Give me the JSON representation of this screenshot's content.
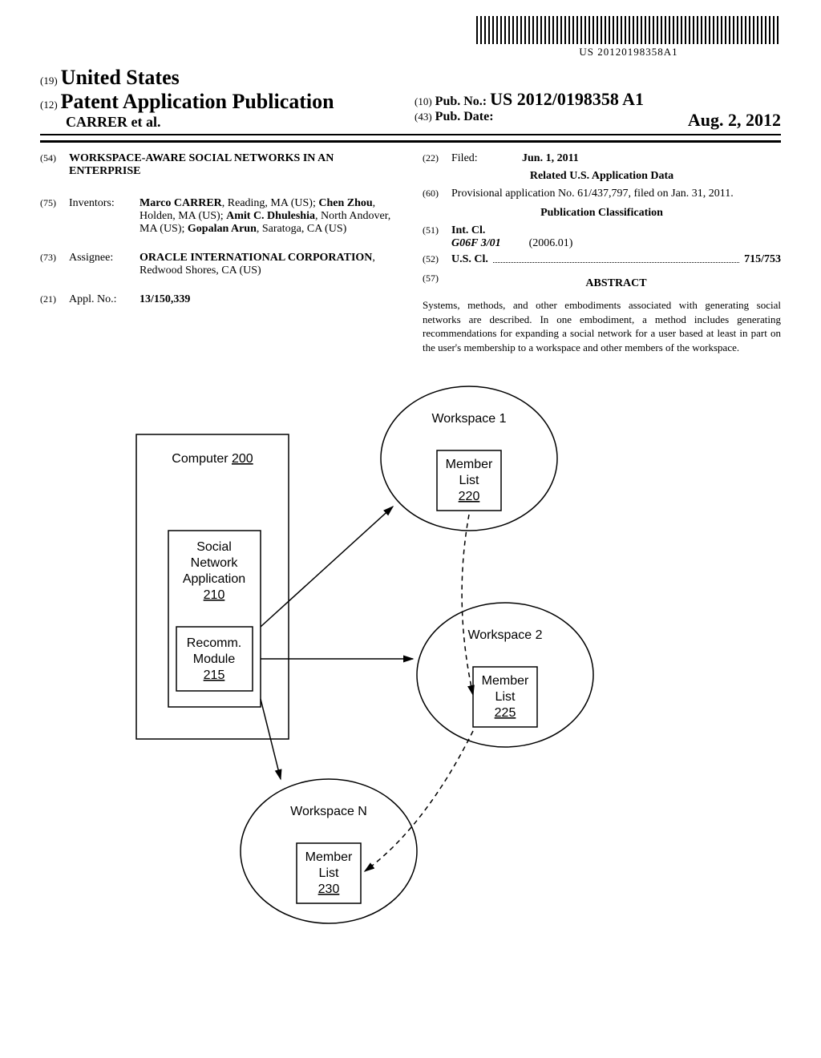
{
  "barcode_text": "US 20120198358A1",
  "country": {
    "num": "(19)",
    "name": "United States"
  },
  "pub_type": {
    "num": "(12)",
    "text": "Patent Application Publication"
  },
  "authors_line": "CARRER et al.",
  "pub_no": {
    "num": "(10)",
    "label": "Pub. No.:",
    "value": "US 2012/0198358 A1"
  },
  "pub_date": {
    "num": "(43)",
    "label": "Pub. Date:",
    "value": "Aug. 2, 2012"
  },
  "title": {
    "num": "(54)",
    "text": "WORKSPACE-AWARE SOCIAL NETWORKS IN AN ENTERPRISE"
  },
  "inventors": {
    "num": "(75)",
    "label": "Inventors:",
    "text_parts": [
      {
        "bold": "Marco CARRER",
        "rest": ", Reading, MA (US); "
      },
      {
        "bold": "Chen Zhou",
        "rest": ", Holden, MA (US); "
      },
      {
        "bold": "Amit C. Dhuleshia",
        "rest": ", North Andover, MA (US); "
      },
      {
        "bold": "Gopalan Arun",
        "rest": ", Saratoga, CA (US)"
      }
    ]
  },
  "assignee": {
    "num": "(73)",
    "label": "Assignee:",
    "bold": "ORACLE INTERNATIONAL CORPORATION",
    "rest": ", Redwood Shores, CA (US)"
  },
  "appl_no": {
    "num": "(21)",
    "label": "Appl. No.:",
    "value": "13/150,339"
  },
  "filed": {
    "num": "(22)",
    "label": "Filed:",
    "value": "Jun. 1, 2011"
  },
  "related_heading": "Related U.S. Application Data",
  "provisional": {
    "num": "(60)",
    "text": "Provisional application No. 61/437,797, filed on Jan. 31, 2011."
  },
  "classification_heading": "Publication Classification",
  "int_cl": {
    "num": "(51)",
    "label": "Int. Cl.",
    "code": "G06F 3/01",
    "year": "(2006.01)"
  },
  "us_cl": {
    "num": "(52)",
    "label": "U.S. Cl.",
    "value": "715/753"
  },
  "abstract": {
    "num": "(57)",
    "heading": "ABSTRACT",
    "text": "Systems, methods, and other embodiments associated with generating social networks are described. In one embodiment, a method includes generating recommendations for expanding a social network for a user based at least in part on the user's membership to a workspace and other members of the workspace."
  },
  "figure": {
    "computer": {
      "label": "Computer",
      "ref": "200"
    },
    "sna": {
      "label": "Social Network Application",
      "ref": "210"
    },
    "recomm": {
      "label": "Recomm. Module",
      "ref": "215"
    },
    "ws1": {
      "label": "Workspace 1",
      "member": "Member List",
      "ref": "220"
    },
    "ws2": {
      "label": "Workspace 2",
      "member": "Member List",
      "ref": "225"
    },
    "wsn": {
      "label": "Workspace N",
      "member": "Member List",
      "ref": "230"
    }
  }
}
